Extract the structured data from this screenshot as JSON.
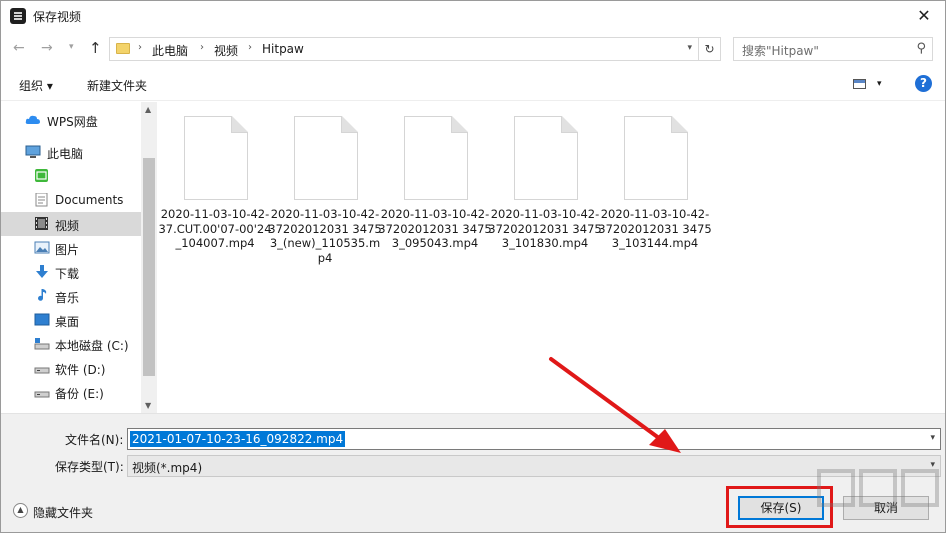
{
  "window": {
    "title": "保存视频",
    "close_glyph": "✕"
  },
  "address": {
    "crumbs": [
      "此电脑",
      "视频",
      "Hitpaw"
    ],
    "search_placeholder": "搜索\"Hitpaw\""
  },
  "toolbar": {
    "organize": "组织 ▾",
    "new_folder": "新建文件夹",
    "help": "?"
  },
  "sidebar": {
    "items": [
      {
        "label": "WPS网盘",
        "icon": "cloud-icon"
      },
      {
        "label": "此电脑",
        "icon": "computer-icon"
      },
      {
        "label": "",
        "icon": "iqiyi-icon"
      },
      {
        "label": "Documents",
        "icon": "documents-icon"
      },
      {
        "label": "视频",
        "icon": "video-icon",
        "selected": true
      },
      {
        "label": "图片",
        "icon": "pictures-icon"
      },
      {
        "label": "下载",
        "icon": "download-icon"
      },
      {
        "label": "音乐",
        "icon": "music-icon"
      },
      {
        "label": "桌面",
        "icon": "desktop-icon"
      },
      {
        "label": "本地磁盘 (C:)",
        "icon": "drive-c-icon"
      },
      {
        "label": "软件 (D:)",
        "icon": "drive-d-icon"
      },
      {
        "label": "备份 (E:)",
        "icon": "drive-e-icon"
      }
    ]
  },
  "files": [
    {
      "name": "2020-11-03-10-42-37.CUT.00'07-00'24_104007.mp4"
    },
    {
      "name": "2020-11-03-10-42-37202012031 34753_(new)_110535.mp4"
    },
    {
      "name": "2020-11-03-10-42-37202012031 34753_095043.mp4"
    },
    {
      "name": "2020-11-03-10-42-37202012031 34753_101830.mp4"
    },
    {
      "name": "2020-11-03-10-42-37202012031 34753_103144.mp4"
    }
  ],
  "form": {
    "filename_label": "文件名(N):",
    "filename_value": "2021-01-07-10-23-16_092822.mp4",
    "type_label": "保存类型(T):",
    "type_value": "视频(*.mp4)",
    "hide_folders": "隐藏文件夹",
    "save_button": "保存(S)",
    "cancel_button": "取消"
  },
  "colors": {
    "selection": "#0078d7",
    "annotation": "#e01818"
  }
}
